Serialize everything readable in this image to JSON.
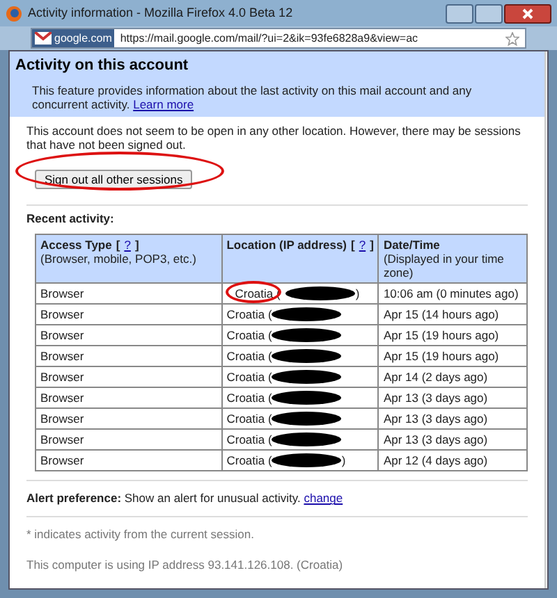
{
  "window": {
    "title": "Activity information - Mozilla Firefox 4.0 Beta 12"
  },
  "address_bar": {
    "site_badge": "google.com",
    "url": "https://mail.google.com/mail/?ui=2&ik=93fe6828a9&view=ac"
  },
  "header": {
    "title": "Activity on this account",
    "description": "This feature provides information about the last activity on this mail account and any concurrent activity.",
    "link": "Learn more"
  },
  "notice": "This account does not seem to be open in any other location. However, there may be sessions that have not been signed out.",
  "sign_out_button": {
    "label": "Sign out all other sessions",
    "circled": true
  },
  "recent_label": "Recent activity:",
  "table": {
    "columns": [
      {
        "title": "Access Type",
        "bracket_open": "[",
        "help": "?",
        "bracket_close": "]",
        "subtitle": "(Browser, mobile, POP3, etc.)"
      },
      {
        "title": "Location (IP address)",
        "bracket_open": "[",
        "help": "?",
        "bracket_close": "]"
      },
      {
        "title": "Date/Time",
        "subtitle": "(Displayed in your time zone)"
      }
    ],
    "rows": [
      {
        "access": "Browser",
        "location": "Croatia (",
        "closing": ")",
        "circled": true,
        "time": "10:06 am (0 minutes ago)"
      },
      {
        "access": "Browser",
        "location": "Croatia (",
        "circled": false,
        "time": "Apr 15 (14 hours ago)"
      },
      {
        "access": "Browser",
        "location": "Croatia (",
        "circled": false,
        "time": "Apr 15 (19 hours ago)"
      },
      {
        "access": "Browser",
        "location": "Croatia (",
        "circled": false,
        "time": "Apr 15 (19 hours ago)"
      },
      {
        "access": "Browser",
        "location": "Croatia (",
        "circled": false,
        "time": "Apr 14 (2 days ago)"
      },
      {
        "access": "Browser",
        "location": "Croatia (",
        "circled": false,
        "time": "Apr 13 (3 days ago)"
      },
      {
        "access": "Browser",
        "location": "Croatia (",
        "circled": false,
        "time": "Apr 13 (3 days ago)"
      },
      {
        "access": "Browser",
        "location": "Croatia (",
        "circled": false,
        "time": "Apr 13 (3 days ago)"
      },
      {
        "access": "Browser",
        "location": "Croatia (",
        "closing": ")",
        "circled": false,
        "time": "Apr 12 (4 days ago)"
      }
    ]
  },
  "alert": {
    "label": "Alert preference:",
    "text": "Show an alert for unusual activity.",
    "link": "change"
  },
  "footnote": "* indicates activity from the current session.",
  "ip_note": "This computer is using IP address 93.141.126.108. (Croatia)"
}
